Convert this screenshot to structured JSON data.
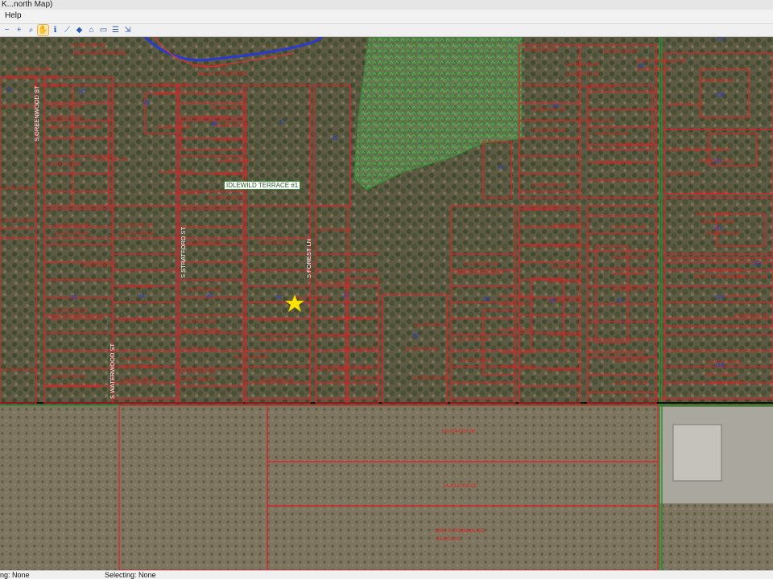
{
  "window": {
    "title": "K...north Map)"
  },
  "menu": {
    "help_label": "Help"
  },
  "toolbar": {
    "tools": [
      {
        "name": "zoom-out-icon",
        "glyph": "−"
      },
      {
        "name": "zoom-in-icon",
        "glyph": "+"
      },
      {
        "name": "magnifier-icon",
        "glyph": "⌕"
      },
      {
        "name": "pan-hand-icon",
        "glyph": "✋",
        "active": true
      },
      {
        "name": "identify-icon",
        "glyph": "ℹ"
      },
      {
        "name": "measure-icon",
        "glyph": "⟋"
      },
      {
        "name": "tag-icon",
        "glyph": "◆"
      },
      {
        "name": "label-icon",
        "glyph": "⌂"
      },
      {
        "name": "select-icon",
        "glyph": "▭"
      },
      {
        "name": "list-icon",
        "glyph": "☰"
      },
      {
        "name": "export-icon",
        "glyph": "⇲"
      }
    ]
  },
  "map": {
    "subdivision_label": "IDLEWILD TERRACE #1",
    "street_labels": [
      {
        "text": "S GREENWOOD ST"
      },
      {
        "text": "S STRATFORD ST"
      },
      {
        "text": "S FOREST LN"
      },
      {
        "text": "S WATERWOOD ST"
      }
    ],
    "parcel_labels": [
      {
        "text": "14-290-005-00"
      },
      {
        "text": "8813 S WATERWOOD"
      },
      {
        "text": "14-290-042-00"
      },
      {
        "text": "8801 S GREENWOOD"
      },
      {
        "text": "14-290-044-00"
      },
      {
        "text": "14-290-014-00"
      },
      {
        "text": "14-290-035-00"
      },
      {
        "text": "8826 S GREENWOOD"
      },
      {
        "text": "14-290-012-00"
      },
      {
        "text": "14-290-020-00"
      },
      {
        "text": "14-291-019-00"
      },
      {
        "text": "14-272-004-00"
      },
      {
        "text": "14-273-001-00"
      },
      {
        "text": "14-273-045-00"
      },
      {
        "text": "14-274-001-02"
      },
      {
        "text": "14-274-045-00"
      },
      {
        "text": "14-274-041-00"
      },
      {
        "text": "14-274-011-00"
      },
      {
        "text": "14-274-006-00"
      },
      {
        "text": "14-275-006-02"
      },
      {
        "text": "8942 S GREENWOOD"
      },
      {
        "text": "14-275-001-01"
      },
      {
        "text": "14-275-011-00"
      },
      {
        "text": "14-275-015-00"
      },
      {
        "text": "8945 S OTTAWA"
      },
      {
        "text": "14-275-019-00"
      },
      {
        "text": "14-276-008-02"
      },
      {
        "text": "342 W 72ND ST"
      },
      {
        "text": "14-275-025-00"
      },
      {
        "text": "14-275-021-00"
      },
      {
        "text": "276 W 72ND ST"
      },
      {
        "text": "14-275-023-01"
      },
      {
        "text": "8978 S GREENWOOD"
      },
      {
        "text": "14-272-022-00"
      },
      {
        "text": "14-288-001-00"
      },
      {
        "text": "8814 S STRATFORD"
      },
      {
        "text": "14-288-031-00"
      },
      {
        "text": "8826 S STRATFORD"
      },
      {
        "text": "14-288-004-00"
      },
      {
        "text": "14-288-007-00"
      },
      {
        "text": "14-288-028-00"
      },
      {
        "text": "14-288-009-01"
      },
      {
        "text": "14-288-010-00"
      },
      {
        "text": "14-288-011-00"
      },
      {
        "text": "14-288-014-00"
      },
      {
        "text": "14-288-016-00"
      },
      {
        "text": "14-288-022-00"
      },
      {
        "text": "14-288-020-00"
      },
      {
        "text": "14-288-019-00"
      },
      {
        "text": "14-276-001-01"
      },
      {
        "text": "14-276-011-00"
      },
      {
        "text": "14-276-035-00"
      },
      {
        "text": "14-276-037-02"
      },
      {
        "text": "14-276-029-00"
      },
      {
        "text": "14-276-021-01"
      },
      {
        "text": "14-277-038-00"
      },
      {
        "text": "14-277-004-02"
      },
      {
        "text": "14-277-004-00"
      },
      {
        "text": "14-277-022-01"
      },
      {
        "text": "14-277-016-00"
      },
      {
        "text": "14-277-012-00"
      },
      {
        "text": "14-277-017-00"
      },
      {
        "text": "8977 S JORDAN ST"
      },
      {
        "text": "14-278-001-01"
      },
      {
        "text": "14-278-015-00"
      },
      {
        "text": "14-278-014-00"
      },
      {
        "text": "14-278-001-03"
      },
      {
        "text": "8929 S CHATAM ST"
      },
      {
        "text": "14-278-031-00"
      },
      {
        "text": "14-278-036-00"
      },
      {
        "text": "14-283-053-00"
      },
      {
        "text": "14-283-020-00"
      },
      {
        "text": "14-283-038-00"
      },
      {
        "text": "14-283-034-00"
      },
      {
        "text": "14-280-049-00"
      },
      {
        "text": "14-280-041-00"
      },
      {
        "text": "14-280-001-01"
      },
      {
        "text": "14-280-045-00"
      },
      {
        "text": "14-280-007-00"
      },
      {
        "text": "14-280-037-01"
      },
      {
        "text": "14-280-030-00"
      },
      {
        "text": "14-280-032-00"
      },
      {
        "text": "14-280-016-02"
      },
      {
        "text": "14-280-026-00"
      },
      {
        "text": "14-280-011-00"
      },
      {
        "text": "14-280-016-00"
      },
      {
        "text": "14-280-020-00"
      },
      {
        "text": "14-282-051-00"
      },
      {
        "text": "14-282-049-00"
      },
      {
        "text": "14-282-046-00"
      },
      {
        "text": "14-282-047-01"
      },
      {
        "text": "14-282-042-00"
      },
      {
        "text": "14-282-011-00"
      },
      {
        "text": "14-282-021-00"
      },
      {
        "text": "14-282-025-00"
      },
      {
        "text": "14-282-012-01"
      },
      {
        "text": "8787 S FORMAN RD"
      },
      {
        "text": "14-281-001-00"
      },
      {
        "text": "14-281-005-00"
      },
      {
        "text": "14-281-014-00"
      },
      {
        "text": "14-281-009-02"
      },
      {
        "text": "14-281-017-00"
      },
      {
        "text": "8978 S CALIFORNIA ST"
      },
      {
        "text": "14-281-019-00"
      },
      {
        "text": "14-281-024-00"
      },
      {
        "text": "14-281-025-00"
      },
      {
        "text": "15-608-004-00"
      },
      {
        "text": "15-608-001-00"
      },
      {
        "text": "15-608-010-00"
      },
      {
        "text": "15-611-006-00"
      },
      {
        "text": "15-611-008-01"
      },
      {
        "text": "15-611-032-00"
      },
      {
        "text": "15-611-024-00"
      },
      {
        "text": "15-612-004-00"
      },
      {
        "text": "15-612-018-00"
      },
      {
        "text": "15-613-004-00"
      },
      {
        "text": "15-615-002-00"
      },
      {
        "text": "8978 S FORMAN RD"
      },
      {
        "text": "15-615-018-00"
      },
      {
        "text": "15-615-023-00"
      },
      {
        "text": "15-616-001-00"
      },
      {
        "text": "15-616-018-00"
      },
      {
        "text": "50 E 72ND ST"
      },
      {
        "text": "14-024-001-00"
      },
      {
        "text": "14-024-002-00"
      },
      {
        "text": "14-024-003-00"
      },
      {
        "text": "9097 S FORMAN RD"
      },
      {
        "text": "15-001-01"
      },
      {
        "text": "14-272-005-01"
      },
      {
        "text": "14-272-030-00"
      }
    ],
    "address_numbers": [
      "50",
      "49",
      "48",
      "47",
      "46",
      "44",
      "43",
      "42",
      "40",
      "39",
      "38",
      "37",
      "36",
      "35",
      "34",
      "33",
      "51",
      "41",
      "107",
      "108",
      "111",
      "112",
      "115",
      "116",
      "113"
    ],
    "marker_icon": "star-marker-icon",
    "colors": {
      "parcel_line": "#e0202a",
      "road_line": "#2d8a2d",
      "river_line": "#2a3ad0",
      "wetland_fill": "#3f9d4a",
      "marker": "#ffe600"
    }
  },
  "status": {
    "left_text": "ng: None",
    "right_text": "Selecting: None"
  }
}
